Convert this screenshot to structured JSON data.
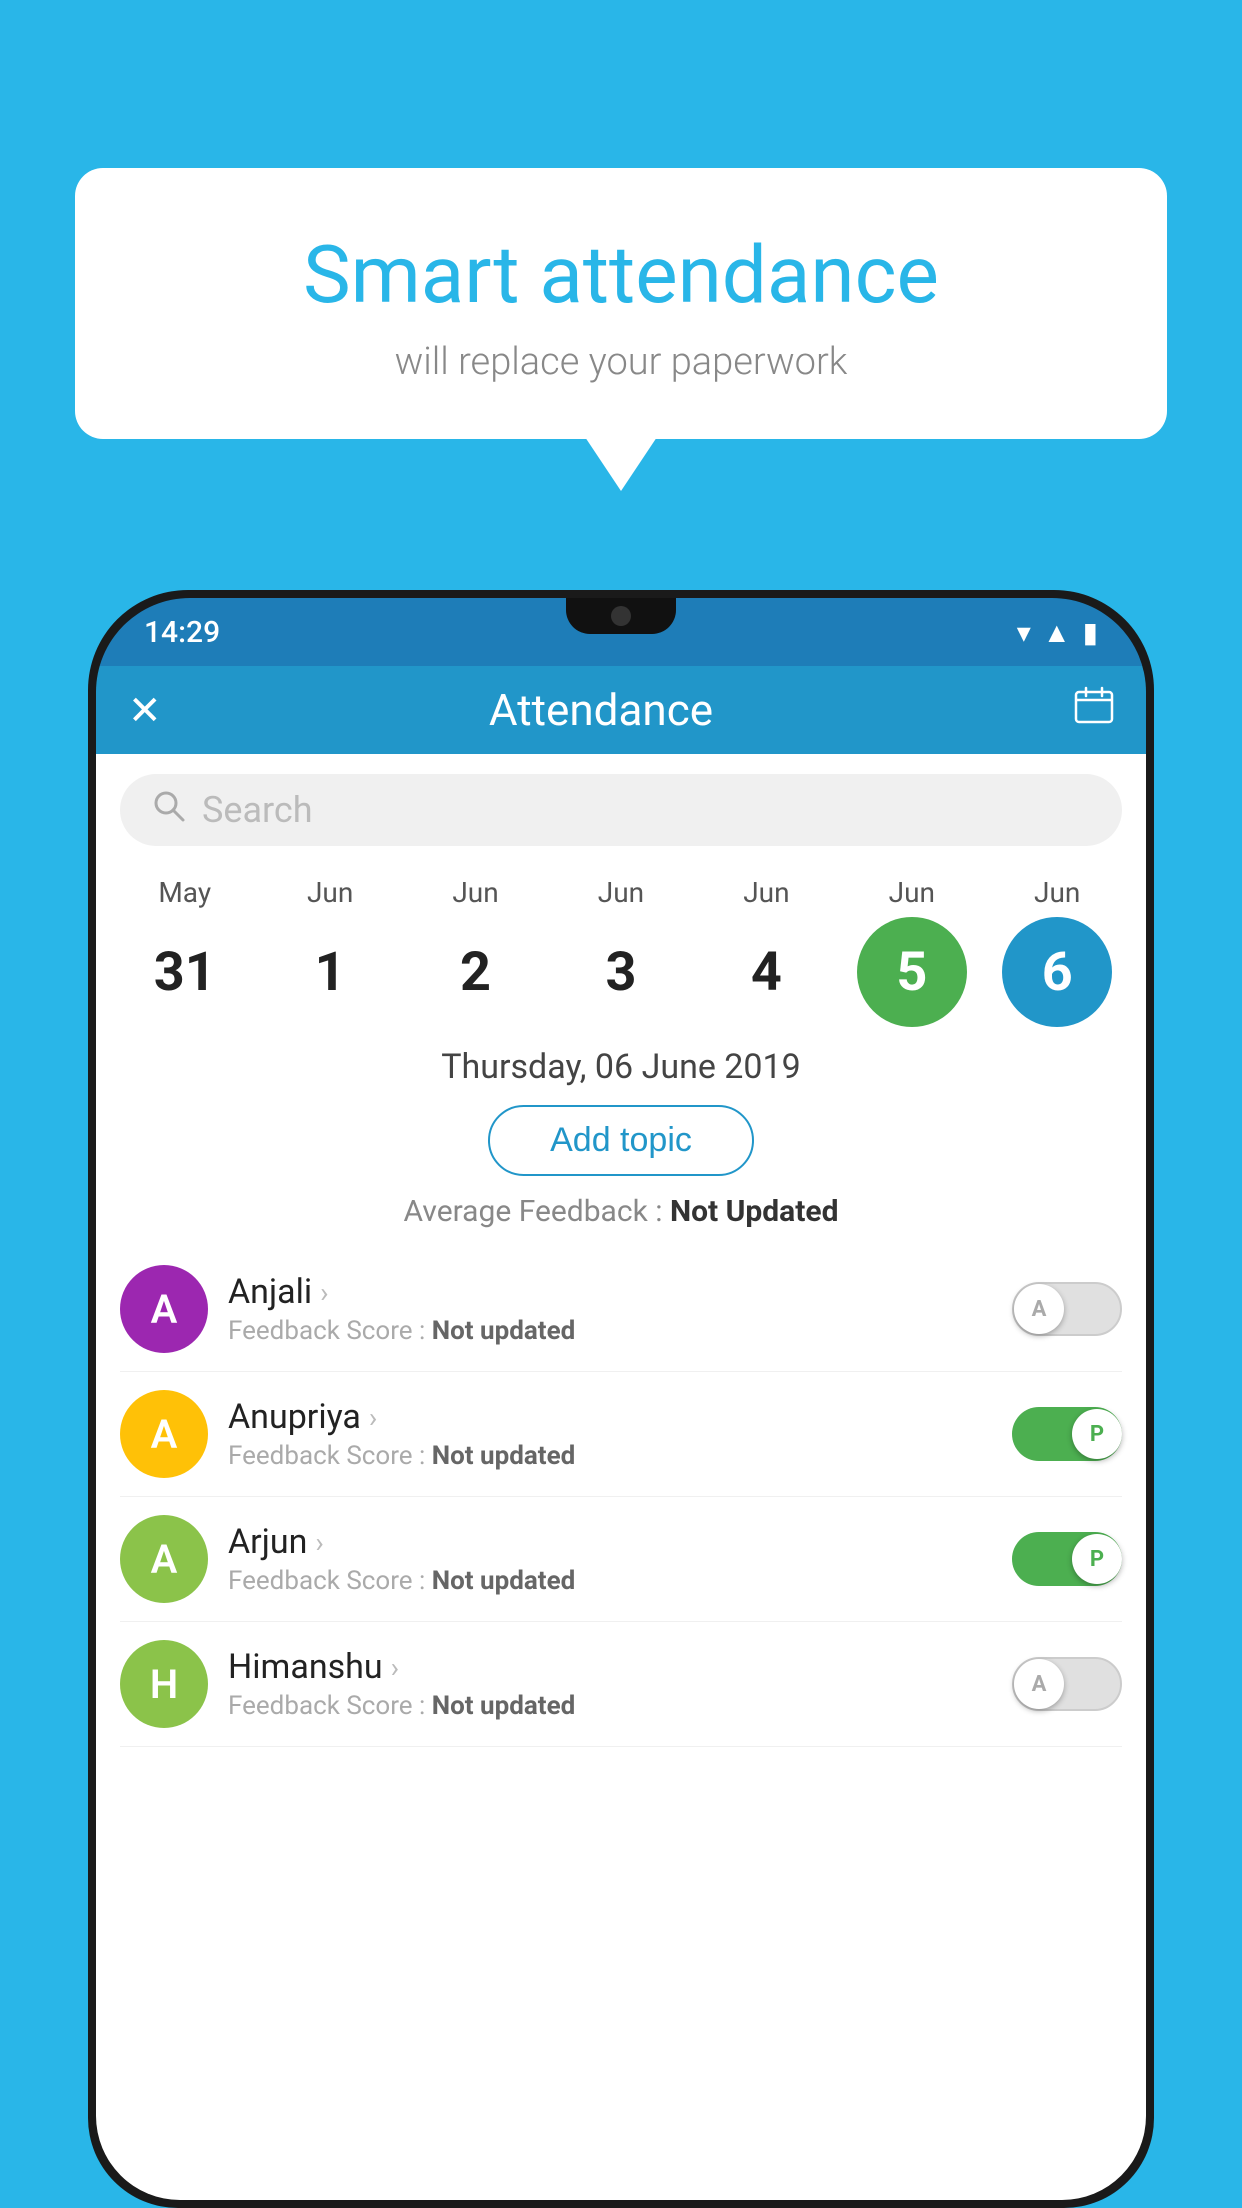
{
  "background_color": "#29b6e8",
  "bubble": {
    "title": "Smart attendance",
    "subtitle": "will replace your paperwork"
  },
  "status_bar": {
    "time": "14:29",
    "wifi_icon": "▾",
    "signal_icon": "▲",
    "battery_icon": "▮"
  },
  "header": {
    "title": "Attendance",
    "close_icon": "✕",
    "calendar_icon": "📅"
  },
  "search": {
    "placeholder": "Search"
  },
  "calendar": {
    "columns": [
      {
        "month": "May",
        "day": "31",
        "type": "normal"
      },
      {
        "month": "Jun",
        "day": "1",
        "type": "normal"
      },
      {
        "month": "Jun",
        "day": "2",
        "type": "normal"
      },
      {
        "month": "Jun",
        "day": "3",
        "type": "normal"
      },
      {
        "month": "Jun",
        "day": "4",
        "type": "normal"
      },
      {
        "month": "Jun",
        "day": "5",
        "type": "selected-green"
      },
      {
        "month": "Jun",
        "day": "6",
        "type": "selected-blue"
      }
    ]
  },
  "selected_date": "Thursday, 06 June 2019",
  "add_topic_label": "Add topic",
  "avg_feedback_label": "Average Feedback : ",
  "avg_feedback_value": "Not Updated",
  "students": [
    {
      "name": "Anjali",
      "avatar_letter": "A",
      "avatar_color": "#9c27b0",
      "feedback_label": "Feedback Score : ",
      "feedback_value": "Not updated",
      "toggle": "off",
      "toggle_letter": "A"
    },
    {
      "name": "Anupriya",
      "avatar_letter": "A",
      "avatar_color": "#ffc107",
      "feedback_label": "Feedback Score : ",
      "feedback_value": "Not updated",
      "toggle": "on",
      "toggle_letter": "P"
    },
    {
      "name": "Arjun",
      "avatar_letter": "A",
      "avatar_color": "#8bc34a",
      "feedback_label": "Feedback Score : ",
      "feedback_value": "Not updated",
      "toggle": "on",
      "toggle_letter": "P"
    },
    {
      "name": "Himanshu",
      "avatar_letter": "H",
      "avatar_color": "#8bc34a",
      "feedback_label": "Feedback Score : ",
      "feedback_value": "Not updated",
      "toggle": "off",
      "toggle_letter": "A"
    }
  ]
}
